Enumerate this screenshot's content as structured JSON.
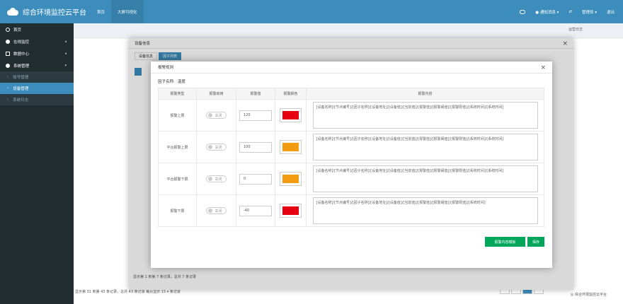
{
  "app": {
    "title": "综合环境监控云平台",
    "tabs": [
      "首页",
      "大屏可视化"
    ],
    "header_right": [
      "●",
      "● 通知消息 ▾",
      "⇄",
      "管理员 ▾",
      "退出"
    ]
  },
  "sidebar": {
    "items": [
      {
        "label": "首页",
        "caret": ""
      },
      {
        "label": "在线监控",
        "caret": "◂"
      },
      {
        "label": "数据中心",
        "caret": "◂"
      },
      {
        "label": "系统管理",
        "caret": "▾"
      }
    ],
    "sub_items": [
      "账号管理",
      "设备管理",
      "系统日志"
    ]
  },
  "background": {
    "right_panel_title": "运营日志",
    "pagination_info": "显示第 31 到第 43 条记录，总共 43 条记录  每页显示 15 ▾ 条记录",
    "help_text": "◎ 综合环境监控云平台"
  },
  "outer_modal": {
    "title": "设备信息",
    "tabs": [
      "设备信息",
      "因子列表"
    ],
    "footer_text": "显示第 1 到第 7 条记录，总共 7 条记录"
  },
  "inner_modal": {
    "title": "报警规则",
    "factor_label": "因子名称:",
    "factor_value": "温度",
    "columns": [
      "报警类型",
      "报警启用",
      "报警值",
      "报警颜色",
      "报警内容"
    ],
    "rows": [
      {
        "type": "报警上限",
        "toggle": "关闭",
        "value": "120",
        "color": "#e60012",
        "content": "[设备名称]/[节点编号]/[因子名称]/[设备地址]/[设备值]/[当前值]/[报警值]/[报警阈值]/[报警限值]/[系统时间]/[系统时间]"
      },
      {
        "type": "平台报警上限",
        "toggle": "关闭",
        "value": "100",
        "color": "#f39c12",
        "content": "[设备名称]/[节点编号]/[因子名称]/[设备地址]/[设备值]/[当前值]/[报警值]/[报警阈值]/[报警限值]/[系统时间]/[系统时间]"
      },
      {
        "type": "平台报警下限",
        "toggle": "关闭",
        "value": "0",
        "color": "#f39c12",
        "content": "[设备名称]/[节点编号]/[因子名称]/[设备地址]/[设备值]/[当前值]/[报警值]/[报警阈值]/[报警限值]/[系统时间]/[系统时间]"
      },
      {
        "type": "报警下限",
        "toggle": "关闭",
        "value": "-40",
        "color": "#e60012",
        "content": "[设备名称]/[节点编号]/[因子名称]/[设备地址]/[设备值]/[当前值]/[报警值]/[报警阈值]/[报警限值]/[系统时间]"
      }
    ],
    "btn_template": "报警内容模板",
    "btn_save": "保存"
  }
}
